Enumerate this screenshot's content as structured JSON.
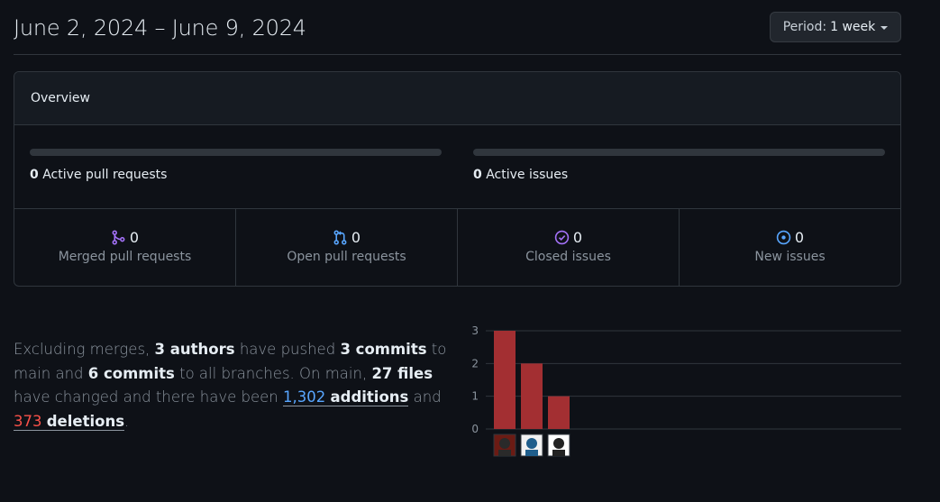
{
  "header": {
    "date_range": "June 2, 2024 – June 9, 2024",
    "period_label": "Period:",
    "period_value": "1 week"
  },
  "overview": {
    "title": "Overview",
    "active_pull_requests": {
      "count": "0",
      "label": "Active pull requests",
      "fill_fraction": 0
    },
    "active_issues": {
      "count": "0",
      "label": "Active issues",
      "fill_fraction": 0
    },
    "stats": [
      {
        "icon": "merged-pr-icon",
        "value": "0",
        "label": "Merged pull requests",
        "color": "#a371f7"
      },
      {
        "icon": "open-pr-icon",
        "value": "0",
        "label": "Open pull requests",
        "color": "#58a6ff"
      },
      {
        "icon": "closed-issue-icon",
        "value": "0",
        "label": "Closed issues",
        "color": "#a371f7"
      },
      {
        "icon": "new-issue-icon",
        "value": "0",
        "label": "New issues",
        "color": "#58a6ff"
      }
    ]
  },
  "summary": {
    "t1": "Excluding merges,",
    "authors": "3 authors",
    "t2": "have pushed",
    "commits_main": "3 commits",
    "t3": "to main and",
    "commits_all": "6 commits",
    "t4": "to all branches. On main,",
    "files": "27 files",
    "t5": "have changed and there have been",
    "additions_num": "1,302",
    "additions_word": "additions",
    "t6": "and",
    "deletions_num": "373",
    "deletions_word": "deletions",
    "t7": "."
  },
  "chart_data": {
    "type": "bar",
    "categories": [
      "author-1",
      "author-2",
      "author-3"
    ],
    "values": [
      3,
      2,
      1
    ],
    "ylim": [
      0,
      3
    ],
    "yticks": [
      0,
      1,
      2,
      3
    ],
    "bar_color": "#a32f32",
    "grid": true,
    "xlabel": "",
    "ylabel": "",
    "title": ""
  }
}
